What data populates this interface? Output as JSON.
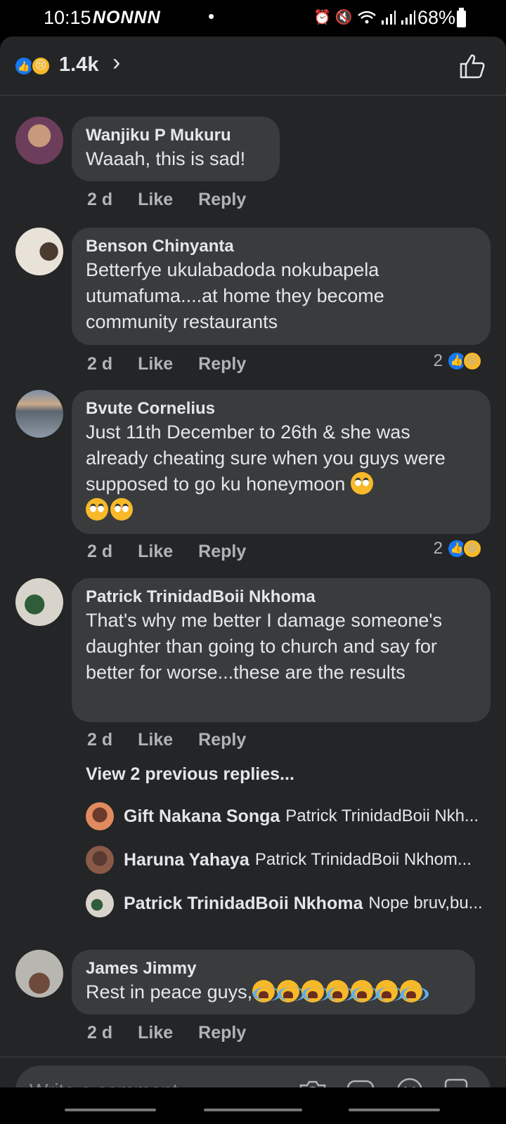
{
  "status_bar": {
    "time": "10:15",
    "notifications": "NONNN",
    "dot": "•",
    "battery": "68%"
  },
  "header": {
    "reaction_count": "1.4k",
    "reactions": [
      "like-icon",
      "sad-face-icon"
    ]
  },
  "comments": [
    {
      "author": "Wanjiku P Mukuru",
      "text": "Waaah, this is sad!",
      "time": "2 d",
      "like_label": "Like",
      "reply_label": "Reply"
    },
    {
      "author": "Benson Chinyanta",
      "text": "Betterfye ukulabadoda nokubapela utumafuma....at home they become community restaurants",
      "time": "2 d",
      "like_label": "Like",
      "reply_label": "Reply",
      "reaction_count": "2",
      "reactions": [
        "like-icon",
        "wow-icon"
      ]
    },
    {
      "author": "Bvute Cornelius",
      "text": "Just 11th December to 26th & she was already cheating sure when you guys were supposed to go ku honeymoon",
      "emoji": "eye-roll-emoji x3",
      "time": "2 d",
      "like_label": "Like",
      "reply_label": "Reply",
      "reaction_count": "2",
      "reactions": [
        "like-icon",
        "haha-icon"
      ]
    },
    {
      "author": "Patrick TrinidadBoii Nkhoma",
      "text": "That's why me better I damage someone's daughter than going to church and say for better for worse...these are the results",
      "time": "2 d",
      "like_label": "Like",
      "reply_label": "Reply",
      "view_previous": "View 2 previous replies...",
      "replies": [
        {
          "author": "Gift Nakana Songa",
          "text": "Patrick TrinidadBoii Nkh..."
        },
        {
          "author": "Haruna Yahaya",
          "text": "Patrick TrinidadBoii Nkhom..."
        },
        {
          "author": "Patrick TrinidadBoii Nkhoma",
          "text": "Nope bruv,bu..."
        }
      ]
    },
    {
      "author": "James Jimmy",
      "text": "Rest in peace guys,",
      "emoji": "crying-emoji x7",
      "time": "2 d",
      "like_label": "Like",
      "reply_label": "Reply"
    }
  ],
  "composer": {
    "placeholder": "Write a comment...",
    "icons": [
      "camera-icon",
      "gif-icon",
      "emoji-icon",
      "sticker-icon"
    ]
  },
  "colors": {
    "panel_bg": "#242526",
    "bubble_bg": "#3a3b3c",
    "text_primary": "#e4e6eb",
    "text_secondary": "#b0b3b8",
    "like_blue": "#1877f2",
    "reaction_yellow": "#f7b928"
  }
}
